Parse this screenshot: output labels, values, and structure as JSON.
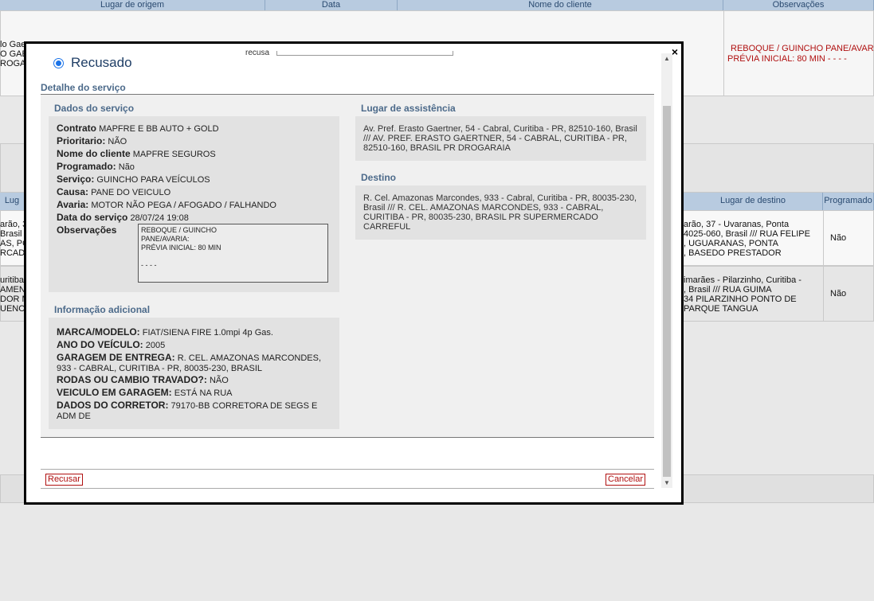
{
  "background": {
    "headers": [
      "Lugar de origem",
      "Data",
      "Nome do cliente",
      "Observações"
    ],
    "headers2": [
      "Lug",
      "Lugar de destino",
      "Programado"
    ],
    "obs_row1": [
      "REBOQUE / GUINCHO PANE/AVAR",
      "PRÉVIA INICIAL: 80 MIN - - - -"
    ],
    "left_frag_row1": [
      "lo Gae",
      "O GAE",
      "ROGA"
    ],
    "left_frag_row2": [
      "arão, 3",
      "Brasil",
      "AS, PO",
      "RCADO"
    ],
    "left_frag_row3": [
      "uritiba",
      "AMENT",
      "DOR M",
      "UENC"
    ],
    "dest_row1": [
      "arão, 37 - Uvaranas, Ponta",
      "4025-060, Brasil /// RUA FELIPE",
      ", UGUARANAS, PONTA",
      ", BASEDO PRESTADOR"
    ],
    "dest_row2": [
      "imarães - Pilarzinho, Curitiba -",
      ", Brasil /// RUA GUIMA",
      "34 PILARZINHO PONTO DE",
      "PARQUE TANGUA"
    ],
    "prog_row1": "Não",
    "prog_row2": "Não"
  },
  "modal": {
    "status_label": "Recusado",
    "recusa_label": "recusa",
    "section_title": "Detalhe do serviço",
    "dados": {
      "title": "Dados do serviço",
      "contrato_label": "Contrato",
      "contrato_value": "MAPFRE E BB AUTO + GOLD",
      "prioritario_label": "Prioritario:",
      "prioritario_value": "NÃO",
      "cliente_label": "Nome do cliente",
      "cliente_value": "MAPFRE SEGUROS",
      "programado_label": "Programado:",
      "programado_value": "Não",
      "servico_label": "Serviço:",
      "servico_value": "GUINCHO PARA VEÍCULOS",
      "causa_label": "Causa:",
      "causa_value": "PANE DO VEICULO",
      "avaria_label": "Avaria:",
      "avaria_value": "MOTOR NÃO PEGA / AFOGADO / FALHANDO",
      "data_label": "Data do serviço",
      "data_value": "28/07/24 19:08",
      "obs_label": "Observações",
      "obs_value": "REBOQUE / GUINCHO\nPANE/AVARIA:\nPRÉVIA INICIAL: 80 MIN\n\n- - - -"
    },
    "assistencia": {
      "title": "Lugar de assistência",
      "lines": [
        "Av. Pref. Erasto Gaertner, 54 - Cabral, Curitiba - PR, 82510-160, Brasil",
        "/// AV. PREF. ERASTO GAERTNER, 54 - CABRAL, CURITIBA - PR,",
        "82510-160, BRASIL PR DROGARAIA"
      ]
    },
    "destino": {
      "title": "Destino",
      "lines": [
        "R. Cel. Amazonas Marcondes, 933 - Cabral, Curitiba - PR, 80035-230,",
        "Brasil /// R. CEL. AMAZONAS MARCONDES, 933 - CABRAL,",
        "CURITIBA - PR, 80035-230, BRASIL PR SUPERMERCADO",
        "CARREFUL"
      ]
    },
    "info": {
      "title": "Informação adicional",
      "marca_label": "MARCA/MODELO:",
      "marca_value": "FIAT/SIENA FIRE 1.0mpi 4p Gas.",
      "ano_label": "ANO DO VEÍCULO:",
      "ano_value": "2005",
      "garagem_label": "GARAGEM DE ENTREGA:",
      "garagem_value": "R. CEL. AMAZONAS MARCONDES,",
      "garagem_value2": "933 - CABRAL, CURITIBA - PR, 80035-230, BRASIL",
      "rodas_label": "RODAS OU CAMBIO TRAVADO?:",
      "rodas_value": "NÃO",
      "veiculo_label": "VEICULO EM GARAGEM:",
      "veiculo_value": "ESTÁ NA RUA",
      "corretor_label": "DADOS DO CORRETOR:",
      "corretor_value": "79170-BB CORRETORA DE SEGS E",
      "corretor_value2": "ADM DE"
    },
    "buttons": {
      "recusar": "Recusar",
      "cancelar": "Cancelar"
    },
    "close": "×"
  }
}
